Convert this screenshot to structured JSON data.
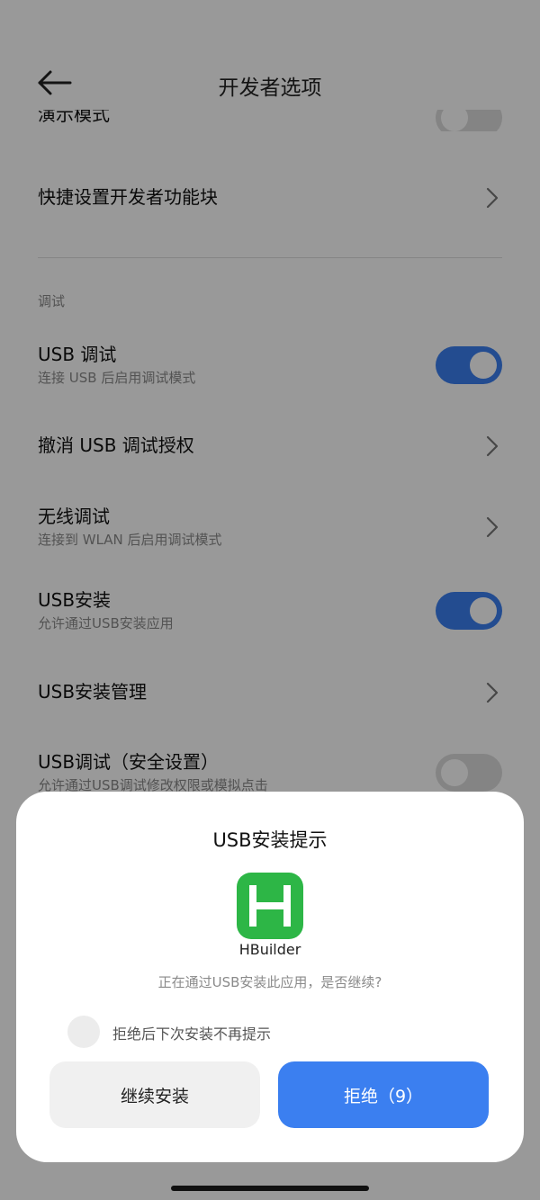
{
  "header": {
    "title": "开发者选项",
    "back_icon": "arrow-left-icon"
  },
  "list": {
    "demo_mode_label": "演示模式",
    "quick_tiles_label": "快捷设置开发者功能块",
    "section_debug": "调试",
    "usb_debug": {
      "title": "USB 调试",
      "subtitle": "连接 USB 后启用调试模式",
      "enabled": true
    },
    "revoke_usb_auth": {
      "title": "撤消 USB 调试授权"
    },
    "wireless_debug": {
      "title": "无线调试",
      "subtitle": "连接到 WLAN 后启用调试模式"
    },
    "usb_install": {
      "title": "USB安装",
      "subtitle": "允许通过USB安装应用",
      "enabled": true
    },
    "usb_install_manage": {
      "title": "USB安装管理"
    },
    "usb_debug_security": {
      "title": "USB调试（安全设置）",
      "subtitle": "允许通过USB调试修改权限或模拟点击",
      "enabled": false
    }
  },
  "dialog": {
    "title": "USB安装提示",
    "app_icon": "hbuilder-app-icon",
    "app_name": "HBuilder",
    "message": "正在通过USB安装此应用，是否继续?",
    "checkbox_label": "拒绝后下次安装不再提示",
    "continue_label": "继续安装",
    "reject_label": "拒绝（9）"
  },
  "colors": {
    "accent": "#3b7ff0",
    "app_icon_bg": "#2db646"
  }
}
